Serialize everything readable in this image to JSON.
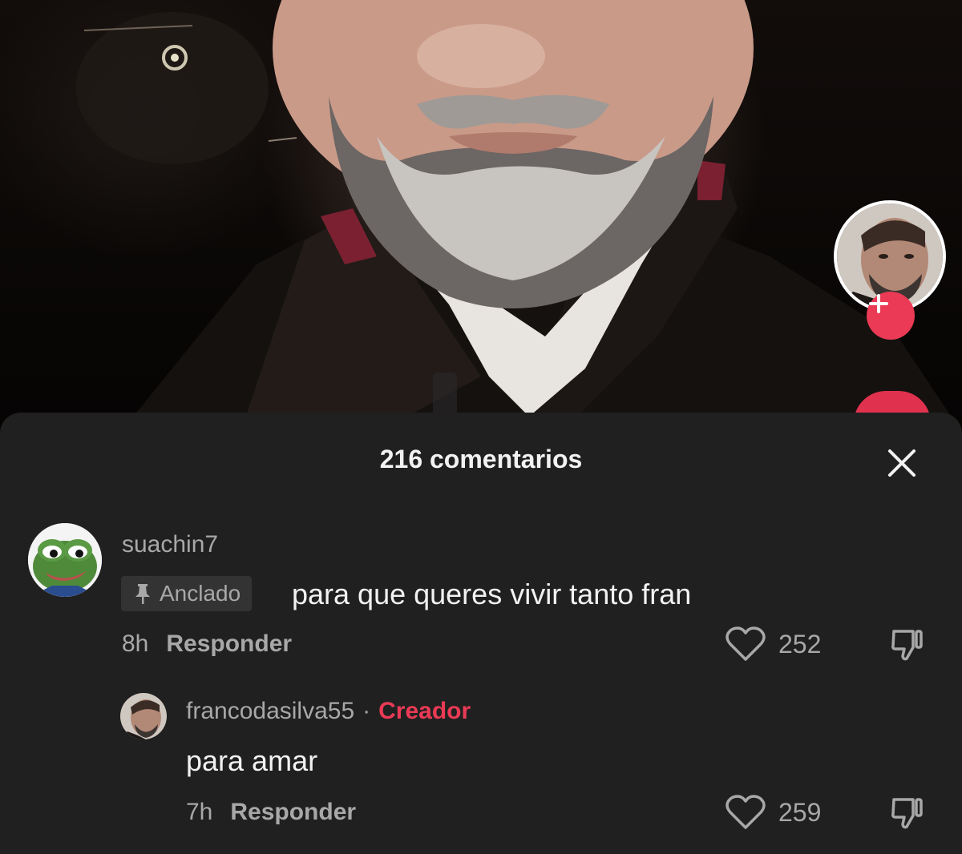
{
  "video": {
    "profile_icon": "creator-avatar",
    "follow_icon": "plus-icon",
    "like_icon": "heart-icon"
  },
  "comments_panel": {
    "title": "216 comentarios",
    "close_icon": "close-icon"
  },
  "comments": [
    {
      "username": "suachin7",
      "avatar_icon": "pepe-frog-avatar",
      "pinned_label": "Anclado",
      "pinned_icon": "pin-icon",
      "text": "para que queres vivir tanto fran",
      "time": "8h",
      "reply_label": "Responder",
      "likes": "252"
    },
    {
      "username": "francodasilva55",
      "separator": "·",
      "badge": "Creador",
      "avatar_icon": "creator-avatar",
      "text": "para amar",
      "time": "7h",
      "reply_label": "Responder",
      "likes": "259"
    }
  ],
  "colors": {
    "sheet_background": "#202020",
    "accent": "#ea3a55",
    "muted_text": "#a8a8a8",
    "primary_text": "#f2f2f2"
  }
}
